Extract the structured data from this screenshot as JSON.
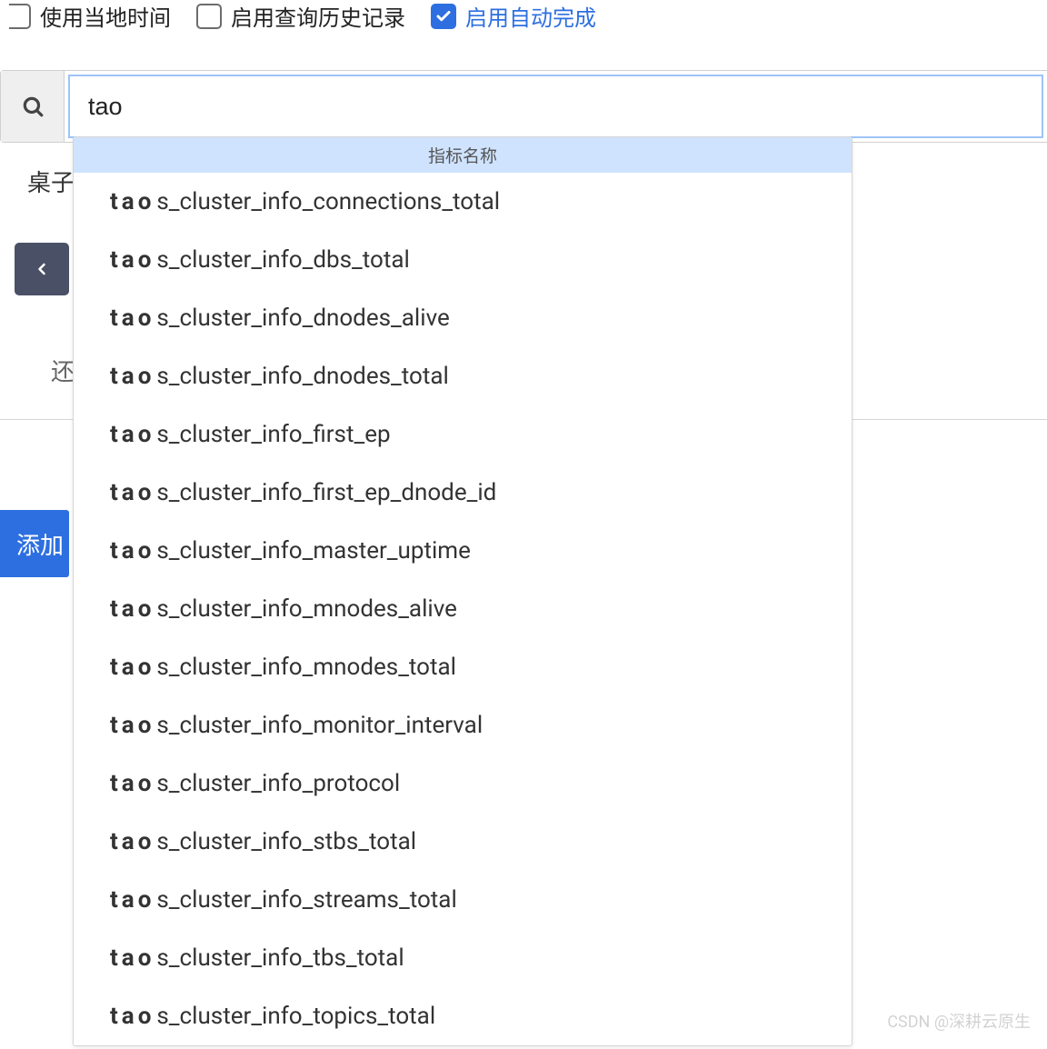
{
  "options": {
    "use_local_time": {
      "label": "使用当地时间",
      "checked": false
    },
    "enable_query_history": {
      "label": "启用查询历史记录",
      "checked": false
    },
    "enable_autocomplete": {
      "label": "启用自动完成",
      "checked": true
    }
  },
  "search": {
    "value": "tao"
  },
  "underlay": {
    "table_heading_fragment": "桌子",
    "text2_fragment": "还",
    "add_button_fragment": "添加"
  },
  "autocomplete": {
    "header": "指标名称",
    "match": "tao",
    "suggestions": [
      "s_cluster_info_connections_total",
      "s_cluster_info_dbs_total",
      "s_cluster_info_dnodes_alive",
      "s_cluster_info_dnodes_total",
      "s_cluster_info_first_ep",
      "s_cluster_info_first_ep_dnode_id",
      "s_cluster_info_master_uptime",
      "s_cluster_info_mnodes_alive",
      "s_cluster_info_mnodes_total",
      "s_cluster_info_monitor_interval",
      "s_cluster_info_protocol",
      "s_cluster_info_stbs_total",
      "s_cluster_info_streams_total",
      "s_cluster_info_tbs_total",
      "s_cluster_info_topics_total"
    ]
  },
  "watermark": "CSDN @深耕云原生"
}
